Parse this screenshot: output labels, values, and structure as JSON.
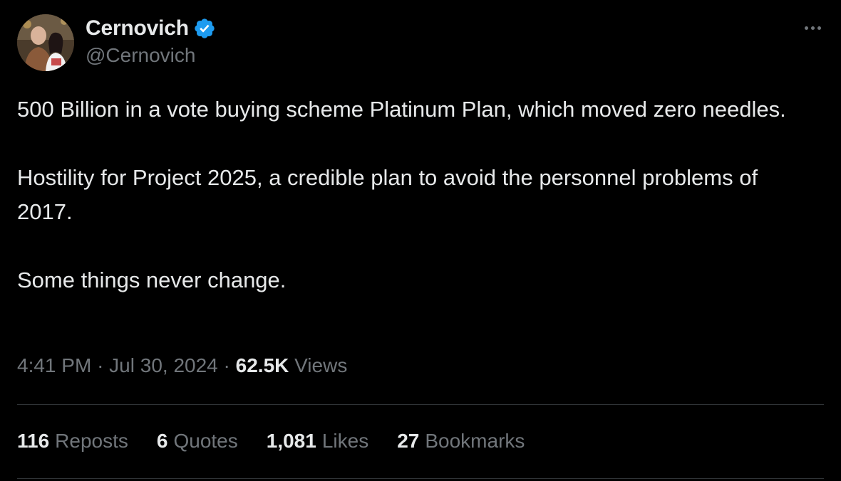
{
  "author": {
    "display_name": "Cernovich",
    "handle": "@Cernovich",
    "verified": true,
    "verified_color": "#1d9bf0"
  },
  "tweet": {
    "paragraphs": [
      "500 Billion in a vote buying scheme Platinum Plan, which moved zero needles.",
      "Hostility for Project 2025, a credible plan to avoid the personnel problems of 2017.",
      "Some things never change."
    ]
  },
  "meta": {
    "time": "4:41 PM",
    "separator": "·",
    "date": "Jul 30, 2024",
    "views_count": "62.5K",
    "views_label": "Views"
  },
  "stats": [
    {
      "count": "116",
      "label": "Reposts"
    },
    {
      "count": "6",
      "label": "Quotes"
    },
    {
      "count": "1,081",
      "label": "Likes"
    },
    {
      "count": "27",
      "label": "Bookmarks"
    }
  ],
  "colors": {
    "background": "#000000",
    "text_primary": "#e7e9ea",
    "text_secondary": "#71767b",
    "divider": "#2f3336"
  },
  "icons": {
    "verified": "verified-badge-icon",
    "more": "more-options-icon"
  }
}
